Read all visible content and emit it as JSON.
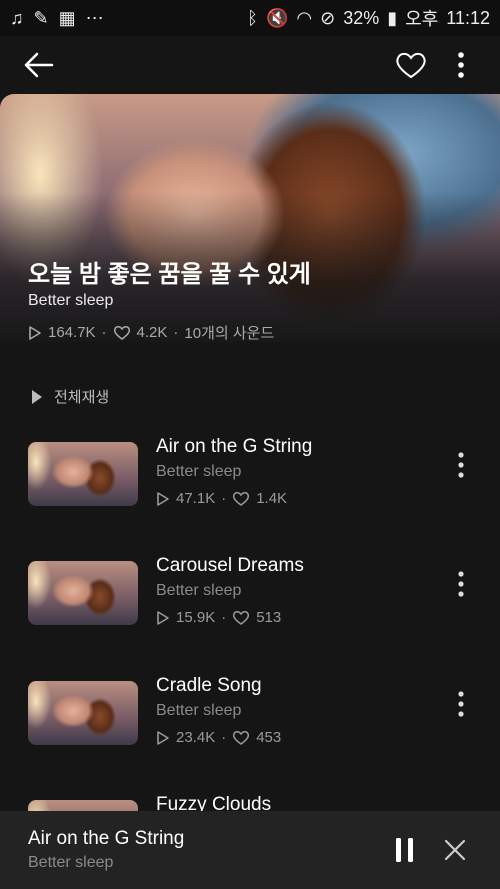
{
  "status_bar": {
    "left_icons": [
      "music-note-icon",
      "feather-icon",
      "grid-icon",
      "dots-icon"
    ],
    "right_icons": [
      "bluetooth-icon",
      "mute-icon",
      "wifi-icon",
      "no-signal-icon"
    ],
    "battery": "32%",
    "ampm": "오후",
    "time": "11:12"
  },
  "playlist": {
    "title": "오늘 밤 좋은 꿈을 꿀 수 있게",
    "subtitle": "Better sleep",
    "plays": "164.7K",
    "likes": "4.2K",
    "count": "10개의 사운드"
  },
  "play_all_label": "전체재생",
  "tracks": [
    {
      "title": "Air on the G String",
      "subtitle": "Better sleep",
      "plays": "47.1K",
      "likes": "1.4K"
    },
    {
      "title": "Carousel Dreams",
      "subtitle": "Better sleep",
      "plays": "15.9K",
      "likes": "513"
    },
    {
      "title": "Cradle Song",
      "subtitle": "Better sleep",
      "plays": "23.4K",
      "likes": "453"
    },
    {
      "title": "Fuzzy Clouds"
    }
  ],
  "now_playing": {
    "title": "Air on the G String",
    "subtitle": "Better sleep"
  },
  "colors": {
    "background": "#151515",
    "mini_player": "#232323",
    "secondary_text": "#8b8b8b"
  }
}
